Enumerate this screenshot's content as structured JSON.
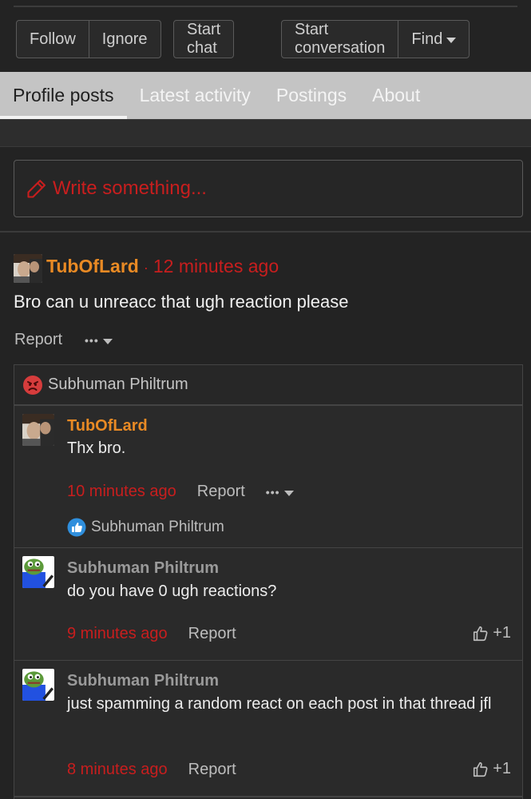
{
  "actions": {
    "follow": "Follow",
    "ignore": "Ignore",
    "start_chat": "Start chat",
    "start_conversation": "Start conversation",
    "find": "Find"
  },
  "tabs": [
    {
      "label": "Profile posts",
      "active": true
    },
    {
      "label": "Latest activity"
    },
    {
      "label": "Postings"
    },
    {
      "label": "About"
    }
  ],
  "composer": {
    "placeholder": "Write something..."
  },
  "post": {
    "author": "TubOfLard",
    "separator": "·",
    "time": "12 minutes ago",
    "text": "Bro can u unreacc that ugh reaction please",
    "report": "Report",
    "more": "•••",
    "reaction_user": "Subhuman Philtrum"
  },
  "comments": [
    {
      "author": "TubOfLard",
      "text": "Thx bro.",
      "time": "10 minutes ago",
      "report": "Report",
      "more": "•••",
      "reacted_by": "Subhuman Philtrum"
    },
    {
      "author": "Subhuman Philtrum",
      "text": "do you have 0 ugh reactions?",
      "time": "9 minutes ago",
      "report": "Report",
      "like": "+1"
    },
    {
      "author": "Subhuman Philtrum",
      "text": "just spamming a random react on each post in that thread jfl",
      "time": "8 minutes ago",
      "report": "Report",
      "like": "+1"
    }
  ],
  "colors": {
    "background": "#232323",
    "author_orange": "#e98a24",
    "timestamp_red": "#c81e1e",
    "tab_bar": "#c4c4c4"
  }
}
